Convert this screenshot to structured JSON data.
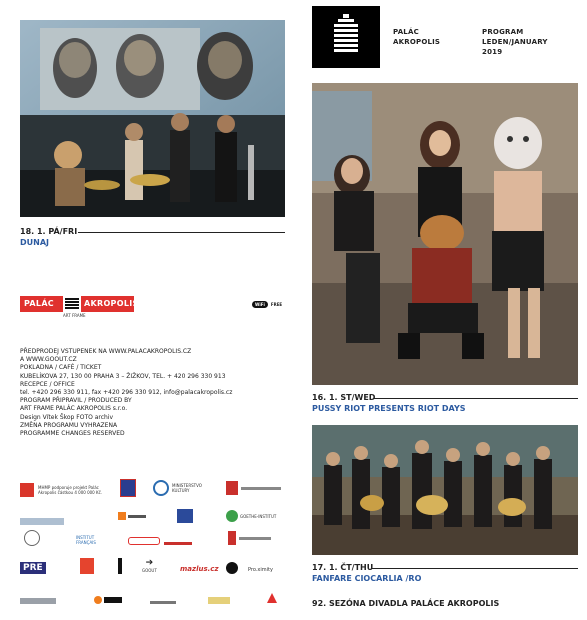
{
  "header": {
    "venue_line1": "PALÁC",
    "venue_line2": "AKROPOLIS",
    "program_line1": "PROGRAM",
    "program_line2": "LEDEN/JANUARY",
    "program_line3": "2019"
  },
  "events": [
    {
      "date": "18. 1. PÁ/FRI",
      "title": "DUNAJ"
    },
    {
      "date": "16. 1. ST/WED",
      "title": "PUSSY RIOT PRESENTS RIOT DAYS"
    },
    {
      "date": "17. 1. ČT/THU",
      "title": "FANFARE CIOCARLIA /RO"
    }
  ],
  "season_line": "92. SEZÓNA DIVADLA PALÁCE AKROPOLIS",
  "brand": {
    "left": "PALÁC",
    "right": "AKROPOLIS",
    "sub": "ART FRAME",
    "accent": "#e0312e"
  },
  "wifi": {
    "badge": "WiFi",
    "label": "FREE"
  },
  "info_lines": [
    "PŘEDPRODEJ VSTUPENEK NA WWW.PALACAKROPOLIS.CZ",
    "A WWW.GOOUT.CZ",
    "POKLADNA / CAFÉ / TICKET",
    "KUBELÍKOVA 27, 130 00 PRAHA 3 – ŽIŽKOV, TEL. + 420 296 330 913",
    "RECEPCE / OFFICE",
    "tel. +420 296 330 911, fax +420 296 330 912, info@palacakropolis.cz",
    "PROGRAM PŘIPRAVIL / PRODUCED BY",
    "ART FRAME PALÁC AKROPOLIS s.r.o.",
    "Design Vítek Škop FOTO archiv",
    "ZMĚNA PROGRAMU VYHRAZENA",
    "PROGRAMME CHANGES RESERVED"
  ],
  "sponsors": {
    "mhmp_text": "MHMP podporuje projekt Palác Akropolis částkou 4 000 000 Kč.",
    "ministry": "MINISTERSTVO KULTURY",
    "institut_francais": "INSTITUT FRANÇAIS",
    "goethe": "GOETHE-INSTITUT",
    "goout": "GOOUT",
    "pre": "PRE",
    "radio": "RADIO 1",
    "mazlus": "mazlus.cz",
    "proximity": "Pro.ximity"
  }
}
